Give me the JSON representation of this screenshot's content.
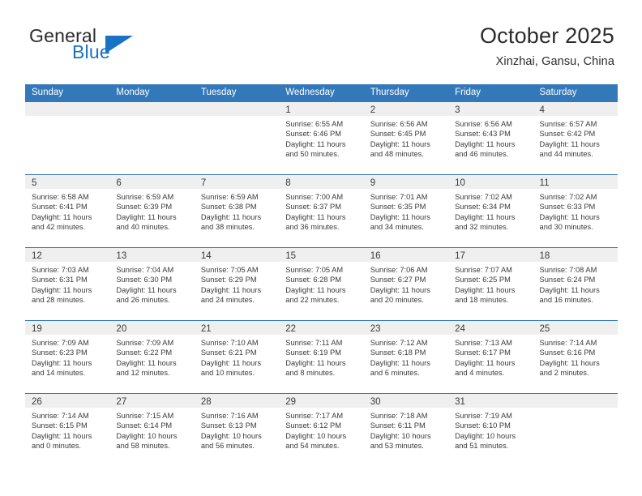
{
  "brand": {
    "name_part1": "General",
    "name_part2": "Blue",
    "logo_icon": "triangle-icon",
    "accent_color": "#1a72c4"
  },
  "header": {
    "title": "October 2025",
    "location": "Xinzhai, Gansu, China"
  },
  "theme": {
    "header_blue": "#3379ba",
    "day_band_gray": "#efefef",
    "text_dark": "#3a3a3a"
  },
  "calendar": {
    "weekdays": [
      "Sunday",
      "Monday",
      "Tuesday",
      "Wednesday",
      "Thursday",
      "Friday",
      "Saturday"
    ],
    "weeks": [
      [
        {
          "day": "",
          "info": ""
        },
        {
          "day": "",
          "info": ""
        },
        {
          "day": "",
          "info": ""
        },
        {
          "day": "1",
          "info": "Sunrise: 6:55 AM\nSunset: 6:46 PM\nDaylight: 11 hours\nand 50 minutes."
        },
        {
          "day": "2",
          "info": "Sunrise: 6:56 AM\nSunset: 6:45 PM\nDaylight: 11 hours\nand 48 minutes."
        },
        {
          "day": "3",
          "info": "Sunrise: 6:56 AM\nSunset: 6:43 PM\nDaylight: 11 hours\nand 46 minutes."
        },
        {
          "day": "4",
          "info": "Sunrise: 6:57 AM\nSunset: 6:42 PM\nDaylight: 11 hours\nand 44 minutes."
        }
      ],
      [
        {
          "day": "5",
          "info": "Sunrise: 6:58 AM\nSunset: 6:41 PM\nDaylight: 11 hours\nand 42 minutes."
        },
        {
          "day": "6",
          "info": "Sunrise: 6:59 AM\nSunset: 6:39 PM\nDaylight: 11 hours\nand 40 minutes."
        },
        {
          "day": "7",
          "info": "Sunrise: 6:59 AM\nSunset: 6:38 PM\nDaylight: 11 hours\nand 38 minutes."
        },
        {
          "day": "8",
          "info": "Sunrise: 7:00 AM\nSunset: 6:37 PM\nDaylight: 11 hours\nand 36 minutes."
        },
        {
          "day": "9",
          "info": "Sunrise: 7:01 AM\nSunset: 6:35 PM\nDaylight: 11 hours\nand 34 minutes."
        },
        {
          "day": "10",
          "info": "Sunrise: 7:02 AM\nSunset: 6:34 PM\nDaylight: 11 hours\nand 32 minutes."
        },
        {
          "day": "11",
          "info": "Sunrise: 7:02 AM\nSunset: 6:33 PM\nDaylight: 11 hours\nand 30 minutes."
        }
      ],
      [
        {
          "day": "12",
          "info": "Sunrise: 7:03 AM\nSunset: 6:31 PM\nDaylight: 11 hours\nand 28 minutes."
        },
        {
          "day": "13",
          "info": "Sunrise: 7:04 AM\nSunset: 6:30 PM\nDaylight: 11 hours\nand 26 minutes."
        },
        {
          "day": "14",
          "info": "Sunrise: 7:05 AM\nSunset: 6:29 PM\nDaylight: 11 hours\nand 24 minutes."
        },
        {
          "day": "15",
          "info": "Sunrise: 7:05 AM\nSunset: 6:28 PM\nDaylight: 11 hours\nand 22 minutes."
        },
        {
          "day": "16",
          "info": "Sunrise: 7:06 AM\nSunset: 6:27 PM\nDaylight: 11 hours\nand 20 minutes."
        },
        {
          "day": "17",
          "info": "Sunrise: 7:07 AM\nSunset: 6:25 PM\nDaylight: 11 hours\nand 18 minutes."
        },
        {
          "day": "18",
          "info": "Sunrise: 7:08 AM\nSunset: 6:24 PM\nDaylight: 11 hours\nand 16 minutes."
        }
      ],
      [
        {
          "day": "19",
          "info": "Sunrise: 7:09 AM\nSunset: 6:23 PM\nDaylight: 11 hours\nand 14 minutes."
        },
        {
          "day": "20",
          "info": "Sunrise: 7:09 AM\nSunset: 6:22 PM\nDaylight: 11 hours\nand 12 minutes."
        },
        {
          "day": "21",
          "info": "Sunrise: 7:10 AM\nSunset: 6:21 PM\nDaylight: 11 hours\nand 10 minutes."
        },
        {
          "day": "22",
          "info": "Sunrise: 7:11 AM\nSunset: 6:19 PM\nDaylight: 11 hours\nand 8 minutes."
        },
        {
          "day": "23",
          "info": "Sunrise: 7:12 AM\nSunset: 6:18 PM\nDaylight: 11 hours\nand 6 minutes."
        },
        {
          "day": "24",
          "info": "Sunrise: 7:13 AM\nSunset: 6:17 PM\nDaylight: 11 hours\nand 4 minutes."
        },
        {
          "day": "25",
          "info": "Sunrise: 7:14 AM\nSunset: 6:16 PM\nDaylight: 11 hours\nand 2 minutes."
        }
      ],
      [
        {
          "day": "26",
          "info": "Sunrise: 7:14 AM\nSunset: 6:15 PM\nDaylight: 11 hours\nand 0 minutes."
        },
        {
          "day": "27",
          "info": "Sunrise: 7:15 AM\nSunset: 6:14 PM\nDaylight: 10 hours\nand 58 minutes."
        },
        {
          "day": "28",
          "info": "Sunrise: 7:16 AM\nSunset: 6:13 PM\nDaylight: 10 hours\nand 56 minutes."
        },
        {
          "day": "29",
          "info": "Sunrise: 7:17 AM\nSunset: 6:12 PM\nDaylight: 10 hours\nand 54 minutes."
        },
        {
          "day": "30",
          "info": "Sunrise: 7:18 AM\nSunset: 6:11 PM\nDaylight: 10 hours\nand 53 minutes."
        },
        {
          "day": "31",
          "info": "Sunrise: 7:19 AM\nSunset: 6:10 PM\nDaylight: 10 hours\nand 51 minutes."
        },
        {
          "day": "",
          "info": ""
        }
      ]
    ]
  }
}
